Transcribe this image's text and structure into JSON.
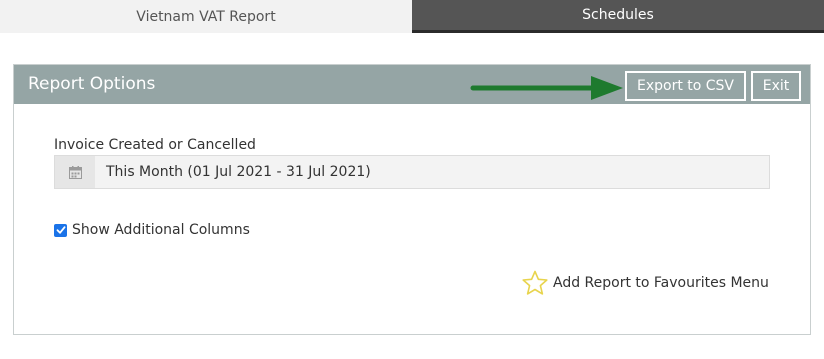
{
  "tabs": [
    {
      "label": "Vietnam VAT Report",
      "active": true
    },
    {
      "label": "Schedules",
      "active": false
    }
  ],
  "panel": {
    "title": "Report Options",
    "export_label": "Export to CSV",
    "exit_label": "Exit"
  },
  "filter": {
    "label": "Invoice Created or Cancelled",
    "value": "This Month (01 Jul 2021 - 31 Jul 2021)",
    "icon": "calendar-icon"
  },
  "options": {
    "show_additional_columns": {
      "label": "Show Additional Columns",
      "checked": true
    }
  },
  "favourites": {
    "label": "Add Report to Favourites Menu",
    "icon": "star-icon"
  },
  "colors": {
    "header_bg": "#95a5a5",
    "active_tab_bg": "#f2f2f2",
    "inactive_tab_bg": "#555555",
    "arrow": "#1e7a2e",
    "checkbox": "#1a73e8",
    "star": "#e8d44d"
  }
}
